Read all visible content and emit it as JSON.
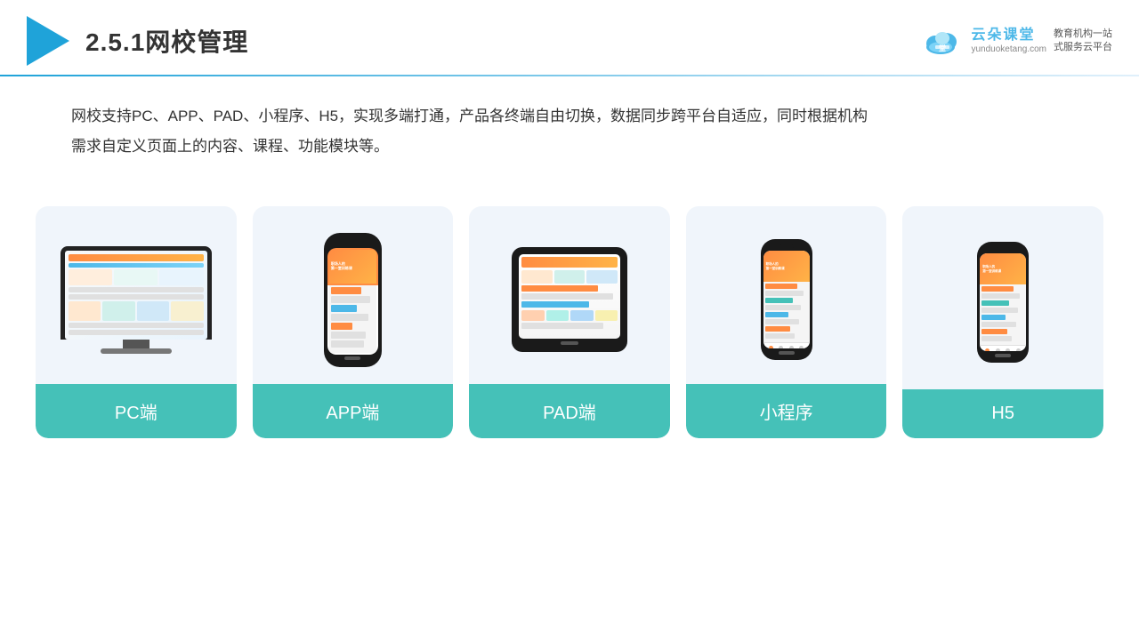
{
  "header": {
    "title": "2.5.1网校管理",
    "brand": {
      "name": "云朵课堂",
      "url": "yunduoketang.com",
      "tagline": "教育机构一站\n式服务云平台"
    }
  },
  "description": "网校支持PC、APP、PAD、小程序、H5，实现多端打通，产品各终端自由切换，数据同步跨平台自适应，同时根据机构\n需求自定义页面上的内容、课程、功能模块等。",
  "cards": [
    {
      "id": "pc",
      "label": "PC端"
    },
    {
      "id": "app",
      "label": "APP端"
    },
    {
      "id": "pad",
      "label": "PAD端"
    },
    {
      "id": "miniprogram",
      "label": "小程序"
    },
    {
      "id": "h5",
      "label": "H5"
    }
  ],
  "accent_color": "#45c1b8",
  "header_line_color": "#1fa3d9"
}
